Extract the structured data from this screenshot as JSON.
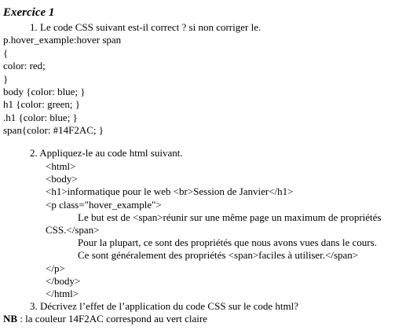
{
  "title": "Exercice 1",
  "q1": "1.   Le code CSS suivant est-il correct ? si non corriger le.",
  "css_code": [
    "p.hover_example:hover span",
    "{",
    "color: red;",
    "}",
    "body {color: blue; }",
    "h1 {color: green; }",
    ".h1 {color: blue; }",
    "span{color: #14F2AC; }"
  ],
  "q2": "2.   Appliquez-le au code html suivant.",
  "html_code": {
    "html_open": "<html>",
    "body_open": "<body>",
    "h1_line": "<h1>informatique pour le web <br>Session de Janvier</h1>",
    "p_open": "<p class=\"hover_example\">",
    "text1_a": "Le but est de <span>réunir sur une même page un maximum de propriétés",
    "text1_b": "CSS.</span>",
    "text2_a": "Pour la plupart, ce sont des propriétés que nous avons vues dans le cours.",
    "text2_b": "Ce sont généralement des propriétés <span>faciles à utiliser.</span>",
    "p_close": "</p>",
    "body_close": "</body>",
    "html_close": "</html>"
  },
  "q3": "3.   Décrivez l’effet de l’application du code CSS sur le code html?",
  "nb_label": "NB",
  "nb_text": " : la couleur 14F2AC correspond au vert claire"
}
